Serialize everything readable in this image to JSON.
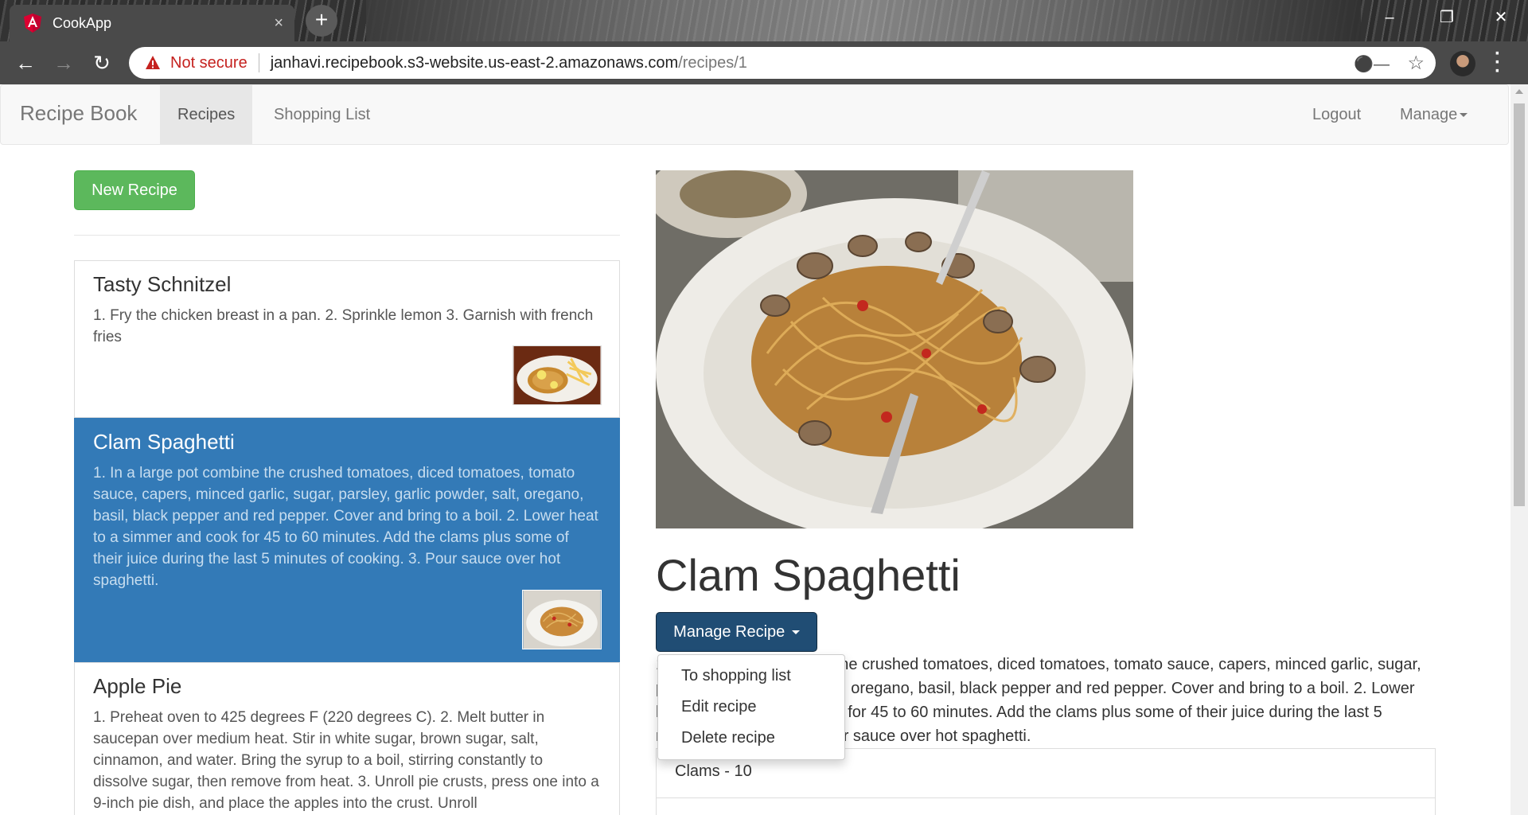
{
  "browser": {
    "tab_title": "CookApp",
    "tab_close": "×",
    "new_tab": "+",
    "url_warning": "Not secure",
    "url_host": "janhavi.recipebook.s3-website.us-east-2.amazonaws.com",
    "url_path": "/recipes/1"
  },
  "navbar": {
    "brand": "Recipe Book",
    "links": [
      "Recipes",
      "Shopping List"
    ],
    "right": {
      "logout": "Logout",
      "manage": "Manage"
    }
  },
  "sidebar": {
    "new_recipe": "New Recipe",
    "recipes": [
      {
        "name": "Tasty Schnitzel",
        "description": "1. Fry the chicken breast in a pan. 2. Sprinkle lemon 3. Garnish with french fries"
      },
      {
        "name": "Clam Spaghetti",
        "description": "1. In a large pot combine the crushed tomatoes, diced tomatoes, tomato sauce, capers, minced garlic, sugar, parsley, garlic powder, salt, oregano, basil, black pepper and red pepper. Cover and bring to a boil. 2. Lower heat to a simmer and cook for 45 to 60 minutes. Add the clams plus some of their juice during the last 5 minutes of cooking. 3. Pour sauce over hot spaghetti."
      },
      {
        "name": "Apple Pie",
        "description": "1. Preheat oven to 425 degrees F (220 degrees C). 2. Melt butter in saucepan over medium heat. Stir in white sugar, brown sugar, salt, cinnamon, and water. Bring the syrup to a boil, stirring constantly to dissolve sugar, then remove from heat. 3. Unroll pie crusts, press one into a 9-inch pie dish, and place the apples into the crust. Unroll"
      }
    ]
  },
  "detail": {
    "title": "Clam Spaghetti",
    "manage_button": "Manage Recipe",
    "dropdown": [
      "To shopping list",
      "Edit recipe",
      "Delete recipe"
    ],
    "description": "1. In a large pot combine the crushed tomatoes, diced tomatoes, tomato sauce, capers, minced garlic, sugar, parsley, garlic powder, salt, oregano, basil, black pepper and red pepper. Cover and bring to a boil. 2. Lower heat to a simmer and cook for 45 to 60 minutes. Add the clams plus some of their juice during the last 5 minutes of cooking. 3. Pour sauce over hot spaghetti.",
    "ingredients": [
      "Clams - 10",
      ""
    ]
  },
  "colors": {
    "success": "#5cb85c",
    "primary_active": "#337ab7",
    "primary_dark": "#204d74",
    "warning_red": "#c5221f"
  }
}
